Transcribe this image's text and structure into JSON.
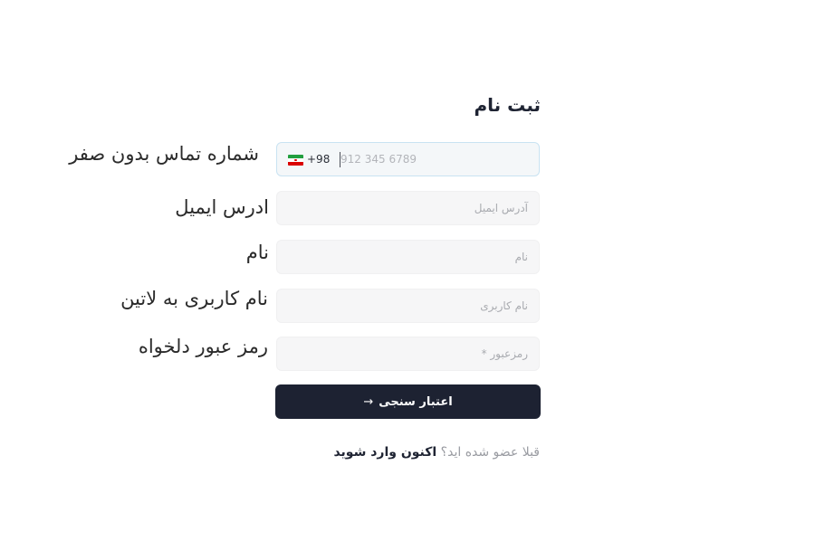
{
  "form": {
    "title": "ثبت نام",
    "phone": {
      "flag": "iran-flag-icon",
      "dial_code": "+98",
      "placeholder": "912 345 6789",
      "side_label": "شماره تماس بدون صفر"
    },
    "email": {
      "placeholder": "آدرس ایمیل",
      "side_label": "ادرس ایمیل"
    },
    "name": {
      "placeholder": "نام",
      "side_label": "نام"
    },
    "username": {
      "placeholder": "نام کاربری",
      "side_label": "نام کاربری به لاتین"
    },
    "password": {
      "placeholder": "رمزعبور *",
      "side_label": "رمز عبور دلخواه"
    },
    "submit": {
      "label": "اعتبار سنجی",
      "icon": "arrow-right-icon"
    },
    "footer": {
      "question": "قبلا عضو شده اید؟",
      "login_link": "اکنون وارد شوید"
    }
  },
  "colors": {
    "button_bg": "#1d2232",
    "field_bg": "#f6f6f7",
    "focus_border": "#c9e3f2",
    "muted_text": "#9a9ca2"
  }
}
